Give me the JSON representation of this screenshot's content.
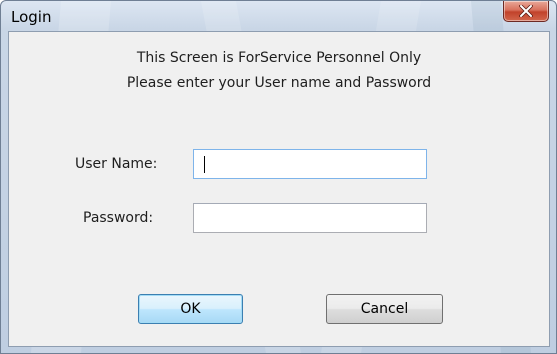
{
  "window": {
    "title": "Login"
  },
  "message": {
    "line1": "This Screen is ForService Personnel Only",
    "line2": "Please enter your User name and Password"
  },
  "form": {
    "username_label": "User Name:",
    "username_value": "",
    "password_label": "Password:",
    "password_value": ""
  },
  "buttons": {
    "ok_label": "OK",
    "cancel_label": "Cancel"
  },
  "icons": {
    "close": "close-icon"
  },
  "colors": {
    "title_bar": "#c9d6e6",
    "close_button": "#c1422b",
    "client_bg": "#f0f0f0",
    "default_button": "#bee6fd"
  }
}
